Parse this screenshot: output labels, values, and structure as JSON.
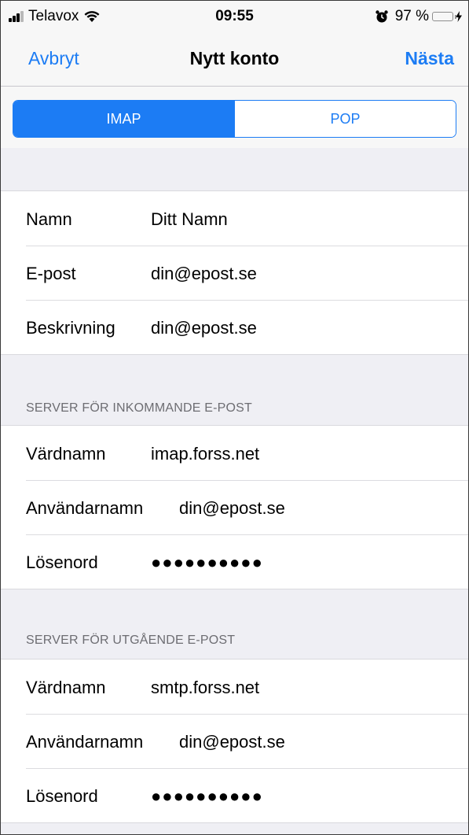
{
  "status_bar": {
    "carrier": "Telavox",
    "time": "09:55",
    "battery_percent": "97 %",
    "battery_level": 0.97,
    "icons": [
      "signal-icon",
      "wifi-icon",
      "alarm-icon",
      "battery-icon",
      "charging-bolt-icon"
    ]
  },
  "nav": {
    "cancel_label": "Avbryt",
    "title": "Nytt konto",
    "next_label": "Nästa"
  },
  "segmented": {
    "options": [
      "IMAP",
      "POP"
    ],
    "selected": "IMAP"
  },
  "account": {
    "rows": [
      {
        "label": "Namn",
        "value": "Ditt Namn"
      },
      {
        "label": "E-post",
        "value": "din@epost.se"
      },
      {
        "label": "Beskrivning",
        "value": "din@epost.se"
      }
    ]
  },
  "incoming": {
    "header": "SERVER FÖR INKOMMANDE E-POST",
    "rows": [
      {
        "label": "Värdnamn",
        "value": "imap.forss.net"
      },
      {
        "label": "Användarnamn",
        "value": "din@epost.se"
      },
      {
        "label": "Lösenord",
        "value": "●●●●●●●●●●"
      }
    ]
  },
  "outgoing": {
    "header": "SERVER FÖR UTGÅENDE E-POST",
    "rows": [
      {
        "label": "Värdnamn",
        "value": "smtp.forss.net"
      },
      {
        "label": "Användarnamn",
        "value": "din@epost.se"
      },
      {
        "label": "Lösenord",
        "value": "●●●●●●●●●●"
      }
    ]
  },
  "colors": {
    "accent": "#1c7cf4",
    "battery": "#4cd964",
    "background": "#efeff4"
  }
}
